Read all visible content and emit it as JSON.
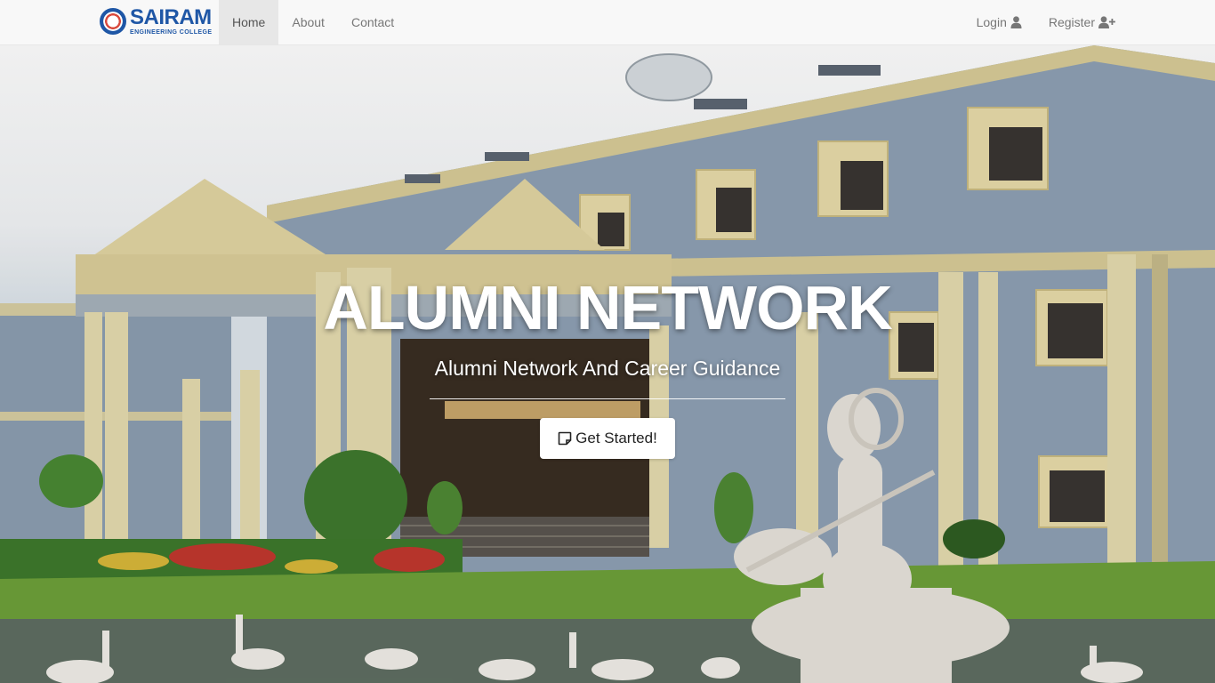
{
  "brand": {
    "name": "SAIRAM",
    "subtitle": "ENGINEERING COLLEGE",
    "color": "#1f57a6"
  },
  "nav": {
    "items": [
      {
        "label": "Home",
        "active": true
      },
      {
        "label": "About",
        "active": false
      },
      {
        "label": "Contact",
        "active": false
      }
    ],
    "login": {
      "label": "Login",
      "icon": "user-icon"
    },
    "register": {
      "label": "Register",
      "icon": "user-plus-icon"
    }
  },
  "hero": {
    "title": "ALUMNI NETWORK",
    "subtitle": "Alumni Network And Career Guidance",
    "cta": {
      "label": "Get Started!",
      "icon": "sticky-note-icon"
    },
    "background": "college-building-photo"
  }
}
